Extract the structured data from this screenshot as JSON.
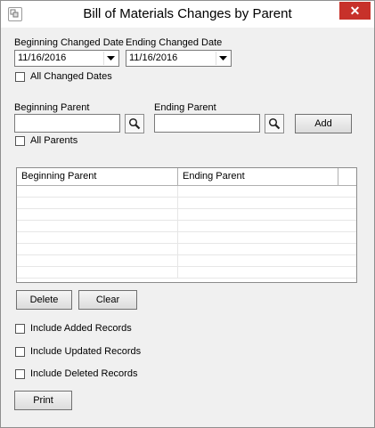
{
  "window": {
    "title": "Bill of Materials Changes by Parent",
    "close_glyph": "✕"
  },
  "dates": {
    "beginning_label": "Beginning Changed Date",
    "beginning_value": "11/16/2016",
    "ending_label": "Ending Changed Date",
    "ending_value": "11/16/2016",
    "all_dates_label": "All Changed Dates",
    "all_dates_checked": false
  },
  "parents": {
    "beginning_label": "Beginning Parent",
    "beginning_value": "",
    "ending_label": "Ending Parent",
    "ending_value": "",
    "add_label": "Add",
    "all_parents_label": "All Parents",
    "all_parents_checked": false
  },
  "grid": {
    "columns": [
      "Beginning Parent",
      "Ending Parent"
    ],
    "rows": []
  },
  "actions": {
    "delete_label": "Delete",
    "clear_label": "Clear",
    "print_label": "Print"
  },
  "options": {
    "include_added": "Include Added Records",
    "include_updated": "Include Updated Records",
    "include_deleted": "Include Deleted Records"
  }
}
